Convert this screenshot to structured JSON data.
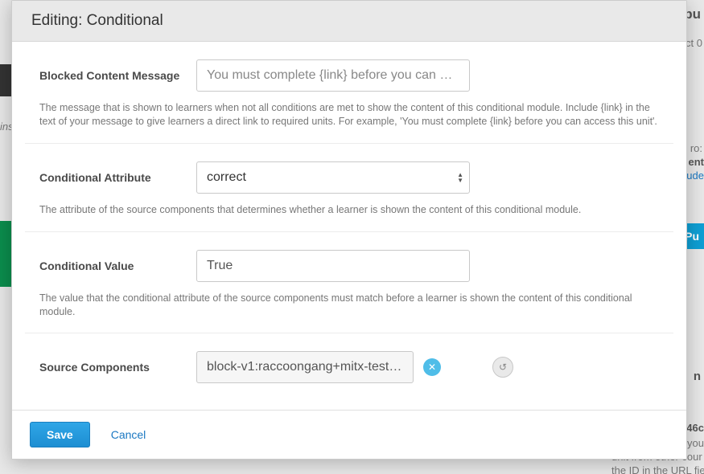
{
  "modal": {
    "title": "Editing: Conditional",
    "fields": {
      "blocked": {
        "label": "Blocked Content Message",
        "placeholder": "You must complete {link} before you can …",
        "help": "The message that is shown to learners when not all conditions are met to show the content of this conditional module. Include {link} in the text of your message to give learners a direct link to required units. For example, 'You must complete {link} before you can access this unit'."
      },
      "attribute": {
        "label": "Conditional Attribute",
        "value": "correct",
        "help": "The attribute of the source components that determines whether a learner is shown the content of this conditional module."
      },
      "value": {
        "label": "Conditional Value",
        "value": "True",
        "help": "The value that the conditional attribute of the source components must match before a learner is shown the content of this conditional module."
      },
      "source": {
        "label": "Source Components",
        "item": "block-v1:raccoongang+mitx-test…"
      }
    },
    "footer": {
      "save": "Save",
      "cancel": "Cancel"
    }
  },
  "background": {
    "pu": "pu",
    "ct0": "ct 0",
    "ro": "ro:",
    "ent": "ent",
    "ude": "ude",
    "publish": "Pu",
    "n": "n",
    "46c": "46c",
    "you": "you",
    "unit_from_other": "unit from other cour",
    "the_id": "the ID in the URL fiel",
    "ins": "ins"
  }
}
